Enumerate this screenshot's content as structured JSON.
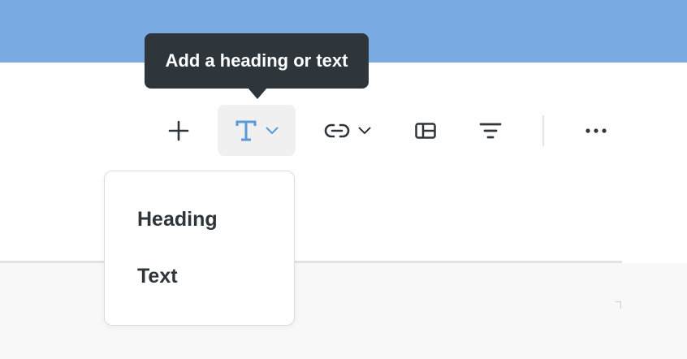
{
  "tooltip": {
    "text": "Add a heading or text"
  },
  "toolbar": {
    "buttons": [
      {
        "name": "add",
        "icon": "plus-icon"
      },
      {
        "name": "heading-or-text",
        "icon": "text-t-icon",
        "active": true,
        "has_dropdown": true
      },
      {
        "name": "link",
        "icon": "link-icon",
        "has_dropdown": true
      },
      {
        "name": "layout",
        "icon": "layout-panel-icon"
      },
      {
        "name": "filter",
        "icon": "filter-lines-icon"
      },
      {
        "name": "more",
        "icon": "more-horizontal-icon"
      }
    ]
  },
  "dropdown_menu": {
    "items": [
      {
        "label": "Heading"
      },
      {
        "label": "Text"
      }
    ]
  },
  "colors": {
    "header_band": "#7babe3",
    "tooltip_bg": "#2e353b",
    "accent_blue": "#5b9ad9",
    "icon_dark": "#2e353b",
    "active_button_bg": "#f0f0f0"
  }
}
